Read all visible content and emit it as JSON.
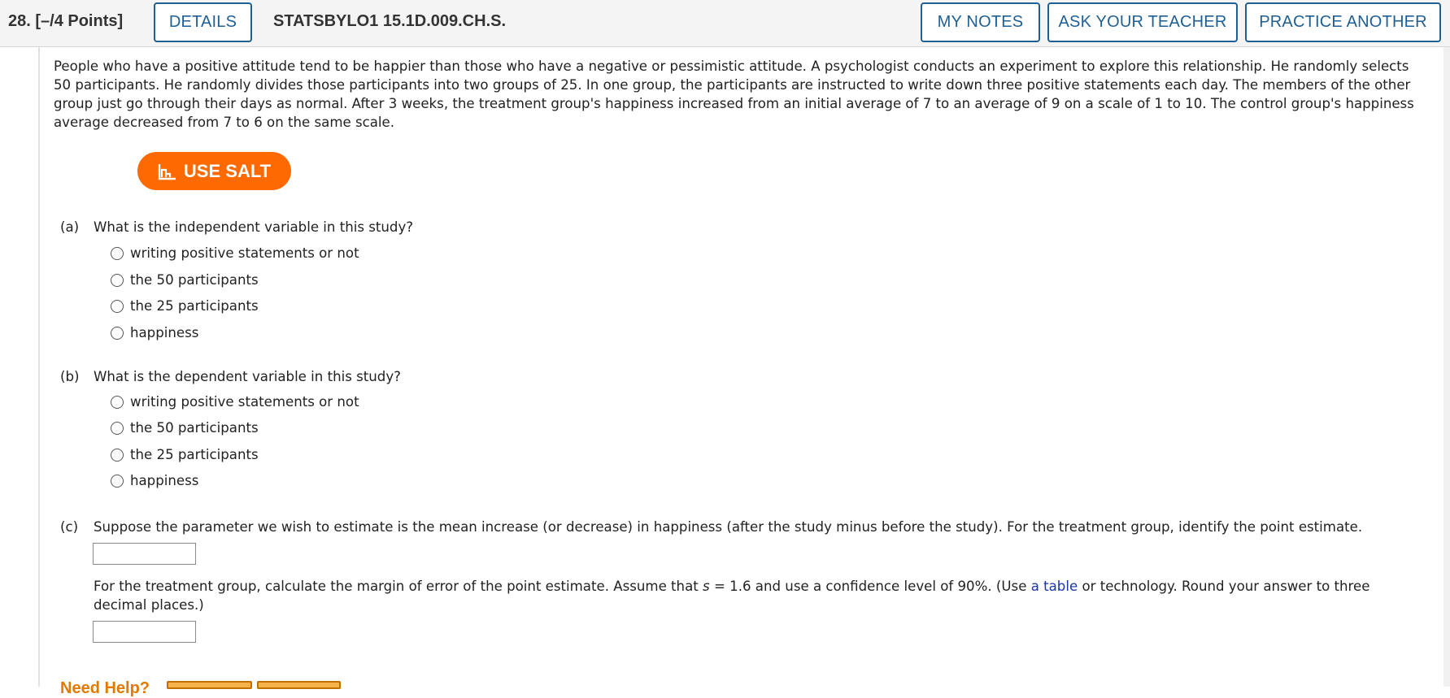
{
  "header": {
    "question_label": "28.  [–/4 Points]",
    "details_label": "DETAILS",
    "question_id": "STATSBYLO1 15.1D.009.CH.S.",
    "my_notes_label": "MY NOTES",
    "ask_teacher_label": "ASK YOUR TEACHER",
    "practice_another_label": "PRACTICE ANOTHER"
  },
  "problem_text": "People who have a positive attitude tend to be happier than those who have a negative or pessimistic attitude. A psychologist conducts an experiment to explore this relationship. He randomly selects 50 participants. He randomly divides those participants into two groups of 25. In one group, the participants are instructed to write down three positive statements each day. The members of the other group just go through their days as normal. After 3 weeks, the treatment group's happiness increased from an initial average of 7 to an average of 9 on a scale of 1 to 10. The control group's happiness average decreased from 7 to 6 on the same scale.",
  "salt_button": {
    "label": "USE SALT",
    "icon": "salt-chart-icon"
  },
  "part_a": {
    "label": "(a)",
    "question": "What is the independent variable in this study?",
    "options": [
      "writing positive statements or not",
      "the 50 participants",
      "the 25 participants",
      "happiness"
    ]
  },
  "part_b": {
    "label": "(b)",
    "question": "What is the dependent variable in this study?",
    "options": [
      "writing positive statements or not",
      "the 50 participants",
      "the 25 participants",
      "happiness"
    ]
  },
  "part_c": {
    "label": "(c)",
    "question": "Suppose the parameter we wish to estimate is the mean increase (or decrease) in happiness (after the study minus before the study). For the treatment group, identify the point estimate.",
    "margin_prefix": "For the treatment group, calculate the margin of error of the point estimate. Assume that ",
    "margin_var": "s",
    "margin_mid": " = 1.6 and use a confidence level of 90%. (Use ",
    "table_link": "a table",
    "margin_suffix": " or technology. Round your answer to three decimal places.)"
  },
  "need_help": {
    "label": "Need Help?"
  },
  "colors": {
    "accent_blue": "#1f5f93",
    "salt_orange": "#ff6a00",
    "link_blue": "#1a35a8",
    "help_orange": "#e07a00"
  }
}
